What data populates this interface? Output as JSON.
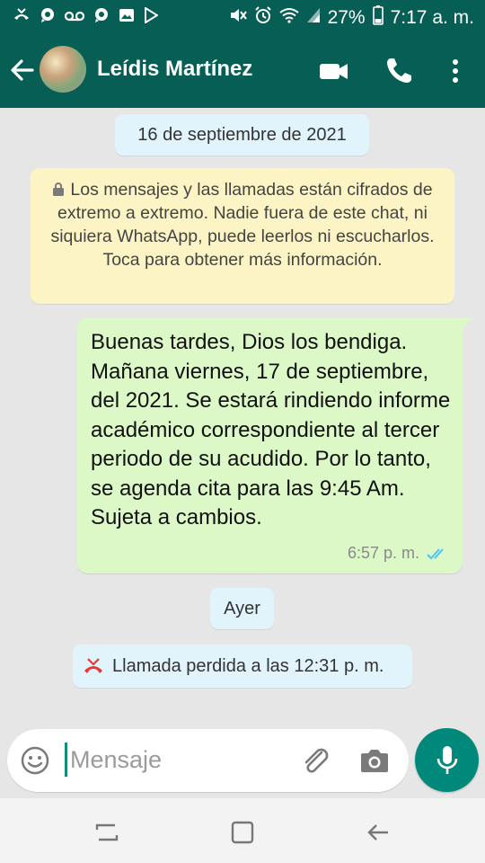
{
  "status_bar": {
    "battery": "27%",
    "time": "7:17 a. m."
  },
  "header": {
    "contact_name": "Leídis Martínez"
  },
  "chat": {
    "date_chip_1": "16 de septiembre de 2021",
    "encryption_notice": "Los mensajes y las llamadas están cifrados de extremo a extremo. Nadie fuera de este chat, ni siquiera WhatsApp, puede leerlos ni escucharlos. Toca para obtener más información.",
    "message": {
      "text": "Buenas tardes, Dios los bendiga. Mañana viernes, 17 de septiembre, del 2021. Se estará rindiendo informe académico correspondiente al tercer periodo de su acudido. Por lo tanto, se agenda cita para las 9:45 Am. Sujeta a cambios.",
      "time": "6:57 p. m.",
      "status_icon": "double-check-read-icon"
    },
    "date_chip_2": "Ayer",
    "missed_call": "Llamada perdida a las 12:31 p. m."
  },
  "composer": {
    "placeholder": "Mensaje",
    "value": ""
  },
  "colors": {
    "header": "#075e54",
    "outgoing_bubble": "#dcf8c6",
    "notice": "#fcf4c4",
    "chip": "#e1f3fb",
    "accent": "#00897b",
    "read_ticks": "#4fc3f7",
    "missed_call": "#e53935"
  }
}
